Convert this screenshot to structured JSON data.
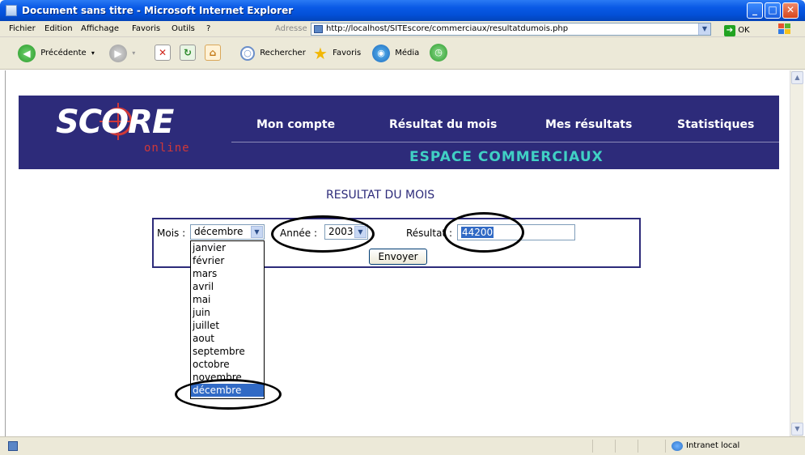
{
  "window": {
    "title": "Document sans titre - Microsoft Internet Explorer",
    "minimize_glyph": "_",
    "maximize_glyph": "□",
    "close_glyph": "✕"
  },
  "menubar": {
    "items": [
      "Fichier",
      "Edition",
      "Affichage",
      "Favoris",
      "Outils",
      "?"
    ],
    "address_label": "Adresse",
    "address_value": "http://localhost/SITEscore/commerciaux/resultatdumois.php",
    "go_label": "OK"
  },
  "toolbar": {
    "back_label": "Précédente",
    "search_label": "Rechercher",
    "favorites_label": "Favoris",
    "media_label": "Média"
  },
  "banner": {
    "logo": "SCORE",
    "logo_sub": "online",
    "nav": [
      "Mon compte",
      "Résultat du mois",
      "Mes résultats",
      "Statistiques"
    ],
    "section": "ESPACE COMMERCIAUX"
  },
  "page": {
    "heading": "RESULTAT DU MOIS"
  },
  "form": {
    "month_label": "Mois :",
    "month_value": "décembre",
    "year_label": "Année :",
    "year_value": "2003",
    "result_label": "Résultat :",
    "result_value": "44200",
    "submit_label": "Envoyer"
  },
  "month_options": [
    "janvier",
    "février",
    "mars",
    "avril",
    "mai",
    "juin",
    "juillet",
    "aout",
    "septembre",
    "octobre",
    "novembre",
    "décembre"
  ],
  "selected_month": "décembre",
  "statusbar": {
    "zone": "Intranet local"
  },
  "colors": {
    "banner": "#2d2b7a",
    "accent": "#40d0c4",
    "selection": "#316ac5",
    "logo_red": "#d03838"
  }
}
